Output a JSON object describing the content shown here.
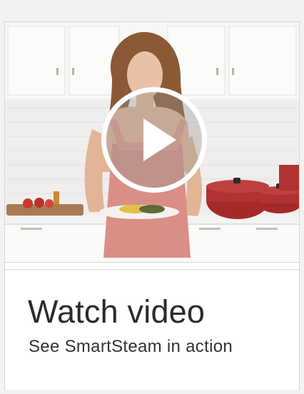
{
  "video_card": {
    "title": "Watch video",
    "subtitle": "See SmartSteam in action",
    "play_icon": "play-icon",
    "colors": {
      "play_ring": "#ffffff",
      "title_text": "#2b2b2b",
      "apron": "#d98f86",
      "pots": "#a52a2a"
    }
  }
}
